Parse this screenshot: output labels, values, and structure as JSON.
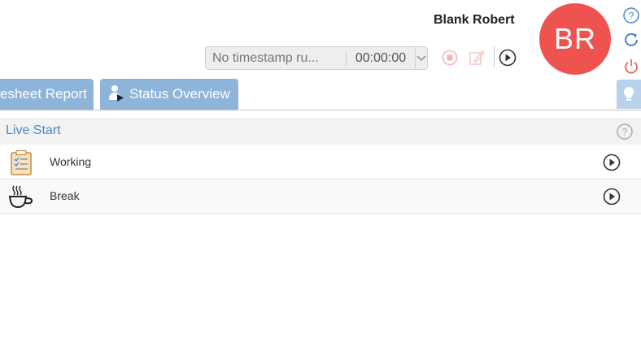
{
  "user": {
    "name": "Blank Robert",
    "initials": "BR",
    "avatar_color": "#ef5350"
  },
  "timer": {
    "status": "No timestamp ru...",
    "time": "00:00:00"
  },
  "tabs": [
    {
      "label": "esheet Report"
    },
    {
      "label": "Status Overview"
    }
  ],
  "section": {
    "title": "Live Start"
  },
  "rows": [
    {
      "label": "Working",
      "icon": "clipboard-checklist-icon"
    },
    {
      "label": "Break",
      "icon": "coffee-cup-icon"
    }
  ],
  "colors": {
    "accent": "#4a86c5",
    "tab_bg": "#8fb4d9",
    "alert": "#ef5350"
  }
}
